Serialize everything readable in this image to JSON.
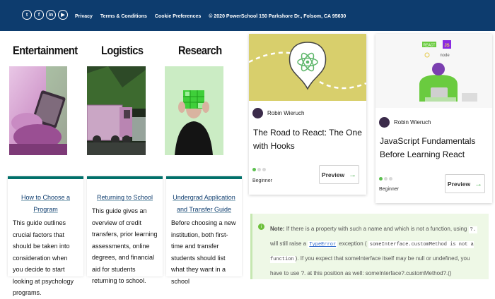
{
  "topbar": {
    "social": [
      {
        "name": "twitter-icon",
        "glyph": "t"
      },
      {
        "name": "facebook-icon",
        "glyph": "f"
      },
      {
        "name": "linkedin-icon",
        "glyph": "in"
      },
      {
        "name": "youtube-icon",
        "glyph": "▶"
      }
    ],
    "links": [
      "Privacy",
      "Terms & Conditions",
      "Cookie Preferences"
    ],
    "copyright": "© 2020 PowerSchool 150 Parkshore Dr., Folsom, CA 95630"
  },
  "categories": [
    {
      "title": "Entertainment"
    },
    {
      "title": "Logistics"
    },
    {
      "title": "Research"
    }
  ],
  "guides": [
    {
      "title": "How to Choose a Program",
      "body": "This guide outlines crucial factors that should be taken into consideration when you decide to start looking at psychology programs."
    },
    {
      "title": "Returning to School",
      "body": "This guide gives an overview of credit transfers, prior learning assessments, online degrees, and financial aid for students returning to school."
    },
    {
      "title": "Undergrad Application and Transfer Guide",
      "body": "Before choosing a new institution, both first-time and transfer students should list what they want in a school"
    }
  ],
  "courses": [
    {
      "author": "Robin Wieruch",
      "title": "The Road to React: The One with Hooks",
      "level": "Beginner",
      "button": "Preview"
    },
    {
      "author": "Robin Wieruch",
      "title": "JavaScript Fundamentals Before Learning React",
      "level": "Beginner",
      "button": "Preview",
      "badges": [
        "REACT",
        "JS",
        "node"
      ]
    }
  ],
  "note": {
    "label": "Note:",
    "t1": "If there is a property with such a name and which is not a function, using",
    "c1": "?.",
    "t2": "will still raise a",
    "link": "TypeError",
    "t3": "exception (",
    "c2": "someInterface.customMethod is not a function",
    "t4": "). If you expect that someInterface itself may be null or undefined, you have to use ?. at this position as well: someInterface?.customMethod?.()"
  },
  "colors": {
    "topbar": "#0d3c6e",
    "guide_accent": "#00706a",
    "note_bg": "#eef8e6",
    "dot_active": "#5cc04f"
  }
}
